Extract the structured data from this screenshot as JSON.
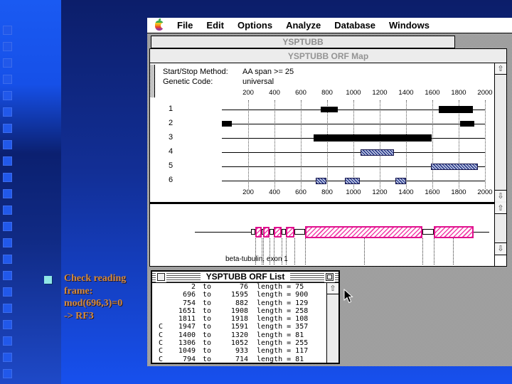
{
  "slide": {
    "note_lines": [
      "Check reading",
      "frame:",
      "mod(696,3)=0",
      "-> RF3"
    ],
    "note_color": "#d28a40",
    "bullet_color": "#8fe6e6"
  },
  "menu_bar": {
    "apple_icon": "apple-logo",
    "items": [
      "File",
      "Edit",
      "Options",
      "Analyze",
      "Database",
      "Windows"
    ]
  },
  "back_window": {
    "title": "YSPTUBB"
  },
  "map_window": {
    "title": "YSPTUBB ORF Map",
    "params": [
      {
        "label": "Start/Stop Method:",
        "value": "AA span >= 25"
      },
      {
        "label": "Genetic Code:",
        "value": "universal"
      }
    ],
    "scroll_up_glyph": "⇧",
    "scroll_down_glyph": "⇩"
  },
  "chart_data": [
    {
      "type": "orf-map",
      "title": "YSPTUBB ORF Map",
      "axis_range": [
        0,
        2000
      ],
      "axis_ticks": [
        200,
        400,
        600,
        800,
        1000,
        1200,
        1400,
        1600,
        1800,
        2000
      ],
      "grid": "dotted-vertical",
      "rows": [
        {
          "frame": "1",
          "style": "solid",
          "orfs": [
            [
              754,
              882
            ],
            [
              1651,
              1908
            ]
          ]
        },
        {
          "frame": "2",
          "style": "solid",
          "orfs": [
            [
              2,
              76
            ],
            [
              1811,
              1918
            ]
          ]
        },
        {
          "frame": "3",
          "style": "solid",
          "orfs": [
            [
              696,
              1595
            ]
          ]
        },
        {
          "frame": "4",
          "style": "hatched",
          "orfs": [
            [
              1052,
              1306
            ]
          ]
        },
        {
          "frame": "5",
          "style": "hatched",
          "orfs": [
            [
              1591,
              1947
            ]
          ]
        },
        {
          "frame": "6",
          "style": "hatched",
          "orfs": [
            [
              714,
              794
            ],
            [
              933,
              1049
            ],
            [
              1320,
              1400
            ]
          ]
        }
      ]
    },
    {
      "type": "gene-structure",
      "label": "beta-tubulin, exon 1",
      "exon_color": "#e0128e",
      "exons_pct": [
        [
          12.3,
          14.7
        ],
        [
          15.3,
          17.7
        ],
        [
          19.3,
          22.0
        ],
        [
          23.8,
          27.0
        ],
        [
          31.0,
          75.0
        ],
        [
          79.2,
          94.2
        ]
      ],
      "connectors_pct": [
        [
          10.6,
          12.3
        ],
        [
          14.7,
          15.3
        ],
        [
          17.7,
          19.3
        ],
        [
          22.0,
          23.8
        ],
        [
          27.0,
          31.0
        ],
        [
          75.0,
          79.2
        ]
      ],
      "dropline_pcts": [
        12.3,
        14.7,
        15.3,
        17.7,
        19.3,
        22.0,
        23.8,
        27.0,
        31.0,
        53.0,
        75.0,
        79.2,
        86.5
      ]
    }
  ],
  "list_window": {
    "title": "YSPTUBB ORF List",
    "to_label": "to",
    "length_label": "length =",
    "rows": [
      {
        "strand": "",
        "start": "2",
        "end": "76",
        "length": "75"
      },
      {
        "strand": "",
        "start": "696",
        "end": "1595",
        "length": "900"
      },
      {
        "strand": "",
        "start": "754",
        "end": "882",
        "length": "129"
      },
      {
        "strand": "",
        "start": "1651",
        "end": "1908",
        "length": "258"
      },
      {
        "strand": "",
        "start": "1811",
        "end": "1918",
        "length": "108"
      },
      {
        "strand": "C",
        "start": "1947",
        "end": "1591",
        "length": "357"
      },
      {
        "strand": "C",
        "start": "1400",
        "end": "1320",
        "length": "81"
      },
      {
        "strand": "C",
        "start": "1306",
        "end": "1052",
        "length": "255"
      },
      {
        "strand": "C",
        "start": "1049",
        "end": "933",
        "length": "117"
      },
      {
        "strand": "C",
        "start": "794",
        "end": "714",
        "length": "81"
      }
    ]
  }
}
